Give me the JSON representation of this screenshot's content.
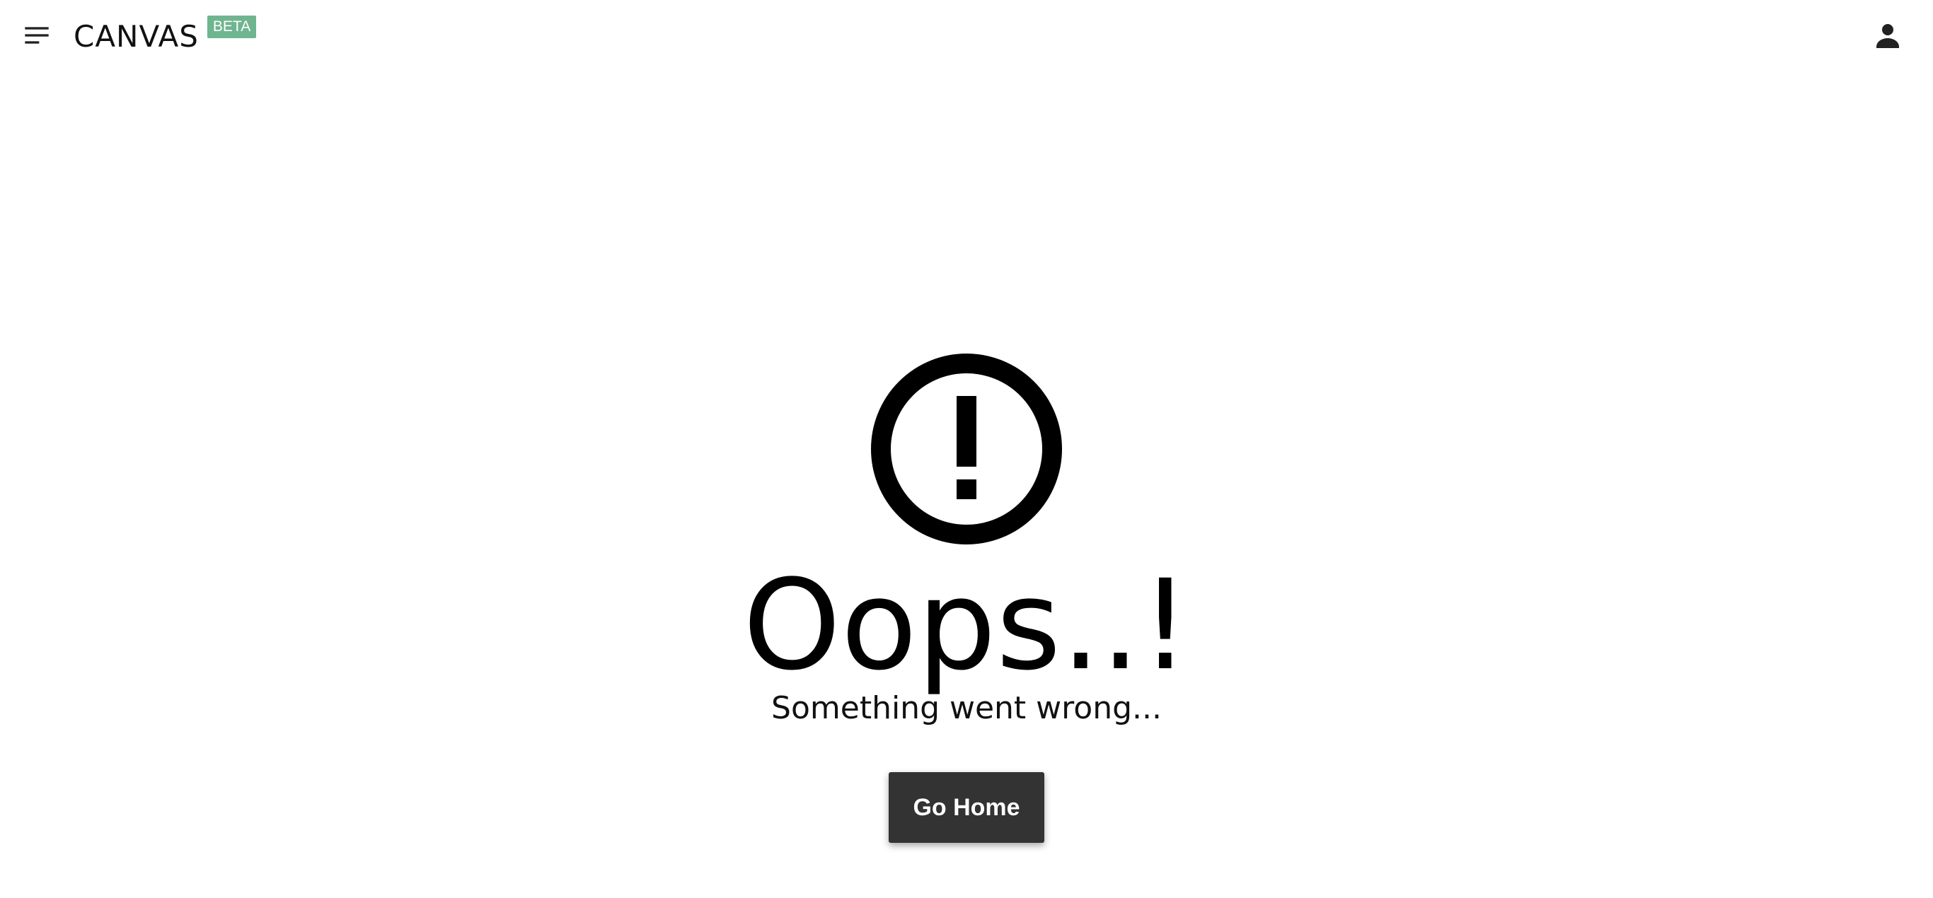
{
  "header": {
    "menu_icon": "hamburger-menu-icon",
    "brand_name": "CANVAS",
    "brand_badge": "BETA",
    "badge_color": "#6fb58f",
    "account_icon": "person-icon"
  },
  "error": {
    "icon": "exclamation-circle-icon",
    "title": "Oops..!",
    "message": "Something went wrong...",
    "button_label": "Go Home",
    "button_color": "#333333"
  }
}
